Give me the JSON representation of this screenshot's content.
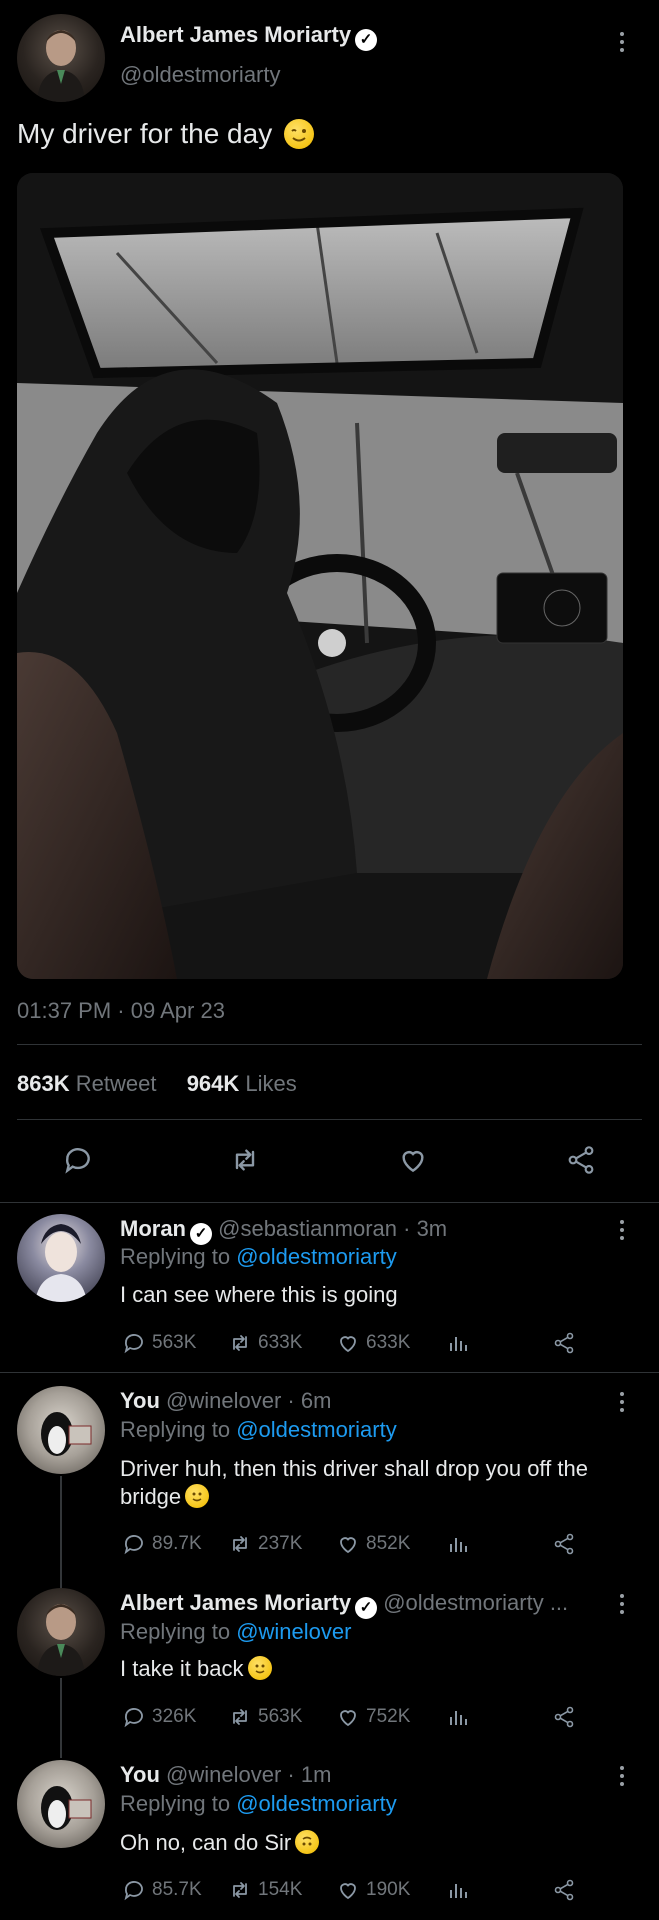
{
  "main_tweet": {
    "author_name": "Albert James Moriarty",
    "author_handle": "@oldestmoriarty",
    "text": "My driver for the day",
    "emoji": "winking-face",
    "time": "01:37 PM",
    "date": "09 Apr 23",
    "retweets_count": "863K",
    "retweets_label": "Retweet",
    "likes_count": "964K",
    "likes_label": "Likes"
  },
  "replies": [
    {
      "author_name": "Moran",
      "author_handle": "@sebastianmoran",
      "time": "3m",
      "replying_label": "Replying to",
      "replying_to": "@oldestmoriarty",
      "text": "I can see where this is going",
      "replies": "563K",
      "retweets": "633K",
      "likes": "633K"
    },
    {
      "author_name": "You",
      "author_handle": "@winelover",
      "time": "6m",
      "replying_label": "Replying to",
      "replying_to": "@oldestmoriarty",
      "text_line1": "Driver huh, then this driver shall drop you off the",
      "text_line2": "bridge",
      "replies": "89.7K",
      "retweets": "237K",
      "likes": "852K"
    },
    {
      "author_name": "Albert James Moriarty",
      "author_handle": "@oldestmoriarty ...",
      "replying_label": "Replying to",
      "replying_to": "@winelover",
      "text": "I take it back",
      "replies": "326K",
      "retweets": "563K",
      "likes": "752K"
    },
    {
      "author_name": "You",
      "author_handle": "@winelover",
      "time": "1m",
      "replying_label": "Replying to",
      "replying_to": "@oldestmoriarty",
      "text": "Oh no, can do Sir",
      "replies": "85.7K",
      "retweets": "154K",
      "likes": "190K"
    }
  ],
  "colors": {
    "background": "#000000",
    "link": "#1d9bf0",
    "muted": "#71767b"
  }
}
